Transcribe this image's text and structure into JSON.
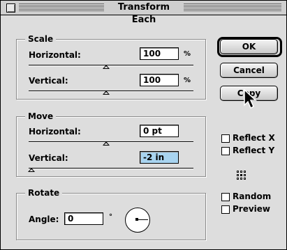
{
  "window": {
    "title": "Transform Each"
  },
  "scale": {
    "label": "Scale",
    "horizontal": {
      "label": "Horizontal:",
      "value": "100",
      "unit": "%"
    },
    "vertical": {
      "label": "Vertical:",
      "value": "100",
      "unit": "%"
    }
  },
  "move": {
    "label": "Move",
    "horizontal": {
      "label": "Horizontal:",
      "value": "0 pt"
    },
    "vertical": {
      "label": "Vertical:",
      "value": "-2 in"
    }
  },
  "rotate": {
    "label": "Rotate",
    "angle": {
      "label": "Angle:",
      "value": "0",
      "unit": "°"
    }
  },
  "buttons": {
    "ok": "OK",
    "cancel": "Cancel",
    "copy": "Copy"
  },
  "options": {
    "reflect_x": {
      "label": "Reflect X",
      "checked": false
    },
    "reflect_y": {
      "label": "Reflect Y",
      "checked": false
    },
    "random": {
      "label": "Random",
      "checked": false
    },
    "preview": {
      "label": "Preview",
      "checked": false
    }
  },
  "colors": {
    "window_bg": "#dddddd",
    "selection": "#a8d4f0"
  }
}
